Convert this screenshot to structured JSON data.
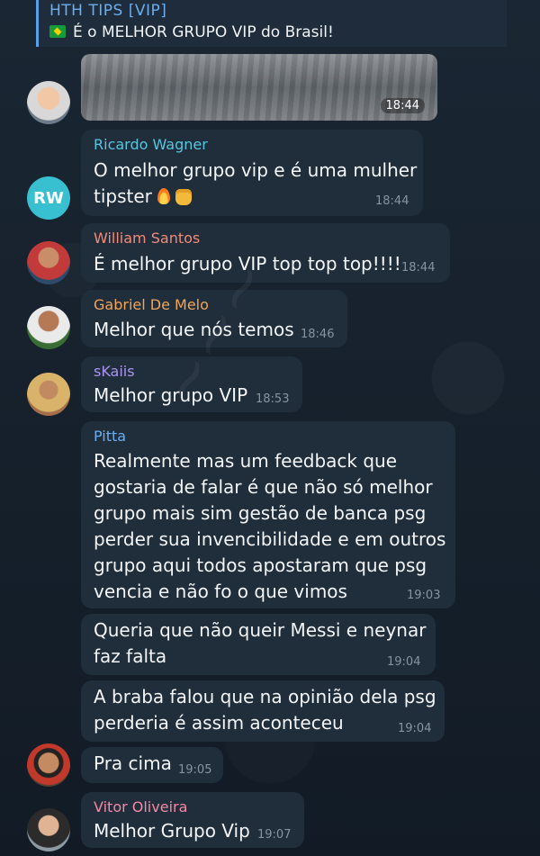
{
  "header": {
    "title": "HTH TIPS [VIP]",
    "reply_text": "É o MELHOR GRUPO VIP do Brasil!"
  },
  "media_message": {
    "time": "18:44"
  },
  "messages": [
    {
      "sender": "Ricardo Wagner",
      "avatar_initials": "RW",
      "lines": [
        "O melhor grupo vip e é uma mulher",
        "tipster"
      ],
      "icons": [
        "fire-icon",
        "fist-icon"
      ],
      "time": "18:44"
    },
    {
      "sender": "William Santos",
      "lines": [
        "É melhor grupo VIP top top top!!!!"
      ],
      "time": "18:44"
    },
    {
      "sender": "Gabriel De Melo",
      "lines": [
        "Melhor que nós temos"
      ],
      "time": "18:46"
    },
    {
      "sender": "sKaiis",
      "lines": [
        "Melhor grupo VIP"
      ],
      "time": "18:53"
    },
    {
      "sender": "Pitta",
      "lines": [
        "Realmente mas um feedback que",
        "gostaria de  falar é que não só melhor",
        "grupo mais sim gestão de banca psg",
        "perder sua invencibilidade e em outros",
        "grupo aqui todos apostaram que psg",
        "vencia e não fo o que vimos"
      ],
      "time": "19:03"
    },
    {
      "sender": "",
      "lines": [
        "Queria que não queir Messi e neynar",
        "faz falta"
      ],
      "time": "19:04"
    },
    {
      "sender": "",
      "lines": [
        "A braba falou que na opinião dela psg",
        "perderia é assim aconteceu"
      ],
      "time": "19:04"
    },
    {
      "sender": "",
      "lines": [
        "Pra cima"
      ],
      "time": "19:05"
    },
    {
      "sender": "Vitor Oliveira",
      "lines": [
        "Melhor Grupo Vip"
      ],
      "time": "19:07"
    }
  ],
  "colors": {
    "background": "#141e28",
    "bubble": "#202d3a",
    "accent": "#6aaef0"
  }
}
